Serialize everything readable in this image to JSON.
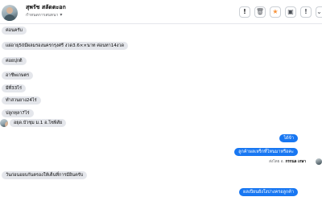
{
  "header": {
    "name": "สุพรัช สลัดตะอก",
    "subtitle": "กำหนดการสนทนา",
    "caret": "▾",
    "buttons": {
      "info": "!",
      "trash": "🗑",
      "star": "★",
      "archive": "▣",
      "alert": "!",
      "more": "⌄"
    }
  },
  "messages": [
    {
      "dir": "in",
      "text": "ค่อนครับ"
    },
    {
      "dir": "in",
      "text": "แผ่อายุ50มีผลมรองนครกรุงศรี งวด3.6××นาท ค่อนทา14งวด"
    },
    {
      "dir": "in",
      "text": "ค่อยปุกติ"
    },
    {
      "dir": "in",
      "text": "อาชีพเกษตร"
    },
    {
      "dir": "in",
      "text": "มีที่33ไร่"
    },
    {
      "dir": "in",
      "text": "ทำสวนยาง24ไร่"
    },
    {
      "dir": "in",
      "text": "ปลูกทุลา7ไร่"
    },
    {
      "dir": "in",
      "text": "อยุด.บัวชุม ม.1 อ.โซพิสัย"
    },
    {
      "dir": "out",
      "text": "ได้จ้า"
    },
    {
      "dir": "out",
      "text": "ลูกค้าผลเหร็กที่ไหนมาหรือคะ"
    },
    {
      "dir": "in",
      "text": "วันก่อนอยบกันตรองให้เต็นที่การมีอินครับ"
    },
    {
      "dir": "out",
      "text": "ผลเปียนยังใงบ่างครอลูกค้า"
    }
  ],
  "seen": {
    "prefix": "ส่งโดย อ.",
    "name": "กรกนล เกษา"
  }
}
